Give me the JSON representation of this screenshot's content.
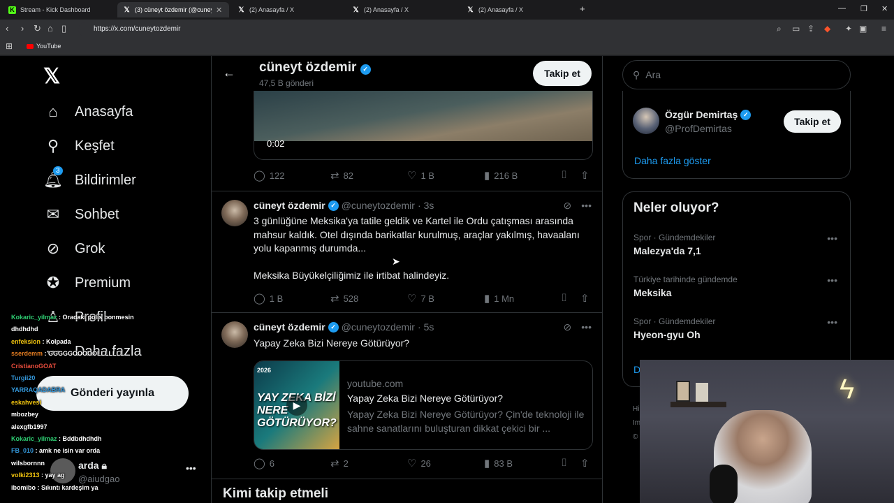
{
  "browser": {
    "tabs": [
      {
        "title": "Stream - Kick Dashboard",
        "icon": "kick-icon"
      },
      {
        "title": "(3) cüneyt özdemir (@cuneytozd",
        "icon": "x-icon"
      },
      {
        "title": "(2) Anasayfa / X",
        "icon": "x-icon"
      },
      {
        "title": "(2) Anasayfa / X",
        "icon": "x-icon"
      },
      {
        "title": "(2) Anasayfa / X",
        "icon": "x-icon"
      }
    ],
    "url": "https://x.com/cuneytozdemir",
    "bookmarks": [
      {
        "label": "YouTube"
      }
    ]
  },
  "nav": {
    "items": [
      {
        "label": "Anasayfa",
        "icon": "home-icon"
      },
      {
        "label": "Keşfet",
        "icon": "search-icon"
      },
      {
        "label": "Bildirimler",
        "icon": "bell-icon",
        "badge": "3"
      },
      {
        "label": "Sohbet",
        "icon": "mail-icon"
      },
      {
        "label": "Grok",
        "icon": "grok-icon"
      },
      {
        "label": "Premium",
        "icon": "verified-icon"
      },
      {
        "label": "Profil",
        "icon": "person-icon"
      },
      {
        "label": "Daha fazla",
        "icon": "more-circle-icon"
      }
    ],
    "post_button": "Gönderi yayınla",
    "account": {
      "name": "arda",
      "handle": "@aiudgao"
    }
  },
  "chat": [
    {
      "user": "Kokaric_yilmaz",
      "msg": "Oradaki polis bonmesin",
      "color": "#2ecc71"
    },
    {
      "user": "",
      "msg": "dhdhdhd",
      "color": "#fff"
    },
    {
      "user": "enfeksion",
      "msg": "Kolpada",
      "color": "#f1c40f"
    },
    {
      "user": "sserdemm",
      "msg": "GGGGGOOOOOLLLLLLL",
      "color": "#e67e22"
    },
    {
      "user": "CristianoGOAT",
      "msg": "",
      "color": "#e74c3c"
    },
    {
      "user": "Turgii20",
      "msg": "",
      "color": "#3498db"
    },
    {
      "user": "YARRAQADABRA",
      "msg": "",
      "color": "#3498db"
    },
    {
      "user": "eskahvesi",
      "msg": "",
      "color": "#f1c40f"
    },
    {
      "user": "mbozbey",
      "msg": "",
      "color": "#fff"
    },
    {
      "user": "alexgfb1997",
      "msg": "",
      "color": "#fff"
    },
    {
      "user": "Kokaric_yilmaz",
      "msg": "Bddbdhdhdh",
      "color": "#2ecc71"
    },
    {
      "user": "FB_010",
      "msg": "amk ne isin var orda",
      "color": "#3498db"
    },
    {
      "user": "wilsbornnn",
      "msg": "",
      "color": "#fff"
    },
    {
      "user": "volki2313",
      "msg": "yay ag",
      "color": "#f1c40f"
    },
    {
      "user": "ibomibo",
      "msg": "Sıkıntı kardeşim ya",
      "color": "#fff"
    }
  ],
  "profile": {
    "name": "cüneyt özdemir",
    "post_count": "47,5 B gönderi",
    "follow_label": "Takip et"
  },
  "video": {
    "time": "0:02"
  },
  "tweets": [
    {
      "stats": {
        "replies": "122",
        "reposts": "82",
        "likes": "1 B",
        "views": "216 B"
      }
    },
    {
      "name": "cüneyt özdemir",
      "handle": "@cuneytozdemir",
      "time": "3s",
      "text1": "3 günlüğüne Meksika'ya tatile geldik ve Kartel ile Ordu çatışması arasında mahsur kaldık. Otel dışında barikatlar kurulmuş, araçlar yakılmış, havaalanı yolu kapanmış durumda...",
      "text2": "Meksika Büyükelçiliğimiz ile irtibat halindeyiz.",
      "stats": {
        "replies": "1 B",
        "reposts": "528",
        "likes": "7 B",
        "views": "1 Mn"
      }
    },
    {
      "name": "cüneyt özdemir",
      "handle": "@cuneytozdemir",
      "time": "5s",
      "text1": "Yapay Zeka Bizi Nereye Götürüyor?",
      "card": {
        "domain": "youtube.com",
        "title": "Yapay Zeka Bizi Nereye Götürüyor?",
        "desc": "Yapay Zeka Bizi Nereye Götürüyor? Çin'de teknoloji ile sahne sanatlarını buluşturan dikkat çekici bir ...",
        "thumb_text": "YAY ZEKA BİZİ NERE GÖTÜRÜYOR?",
        "thumb_year": "2026"
      },
      "stats": {
        "replies": "6",
        "reposts": "2",
        "likes": "26",
        "views": "83 B"
      }
    }
  ],
  "who_to_follow_heading": "Kimi takip etmeli",
  "sidebar": {
    "search_placeholder": "Ara",
    "suggest": {
      "name": "Özgür Demirtaş",
      "handle": "@ProfDemirtas",
      "follow_label": "Takip et"
    },
    "show_more": "Daha fazla göster",
    "trends_title": "Neler oluyor?",
    "trends": [
      {
        "context": "Spor · Gündemdekiler",
        "name": "Malezya'da 7,1"
      },
      {
        "context": "Türkiye tarihinde gündemde",
        "name": "Meksika"
      },
      {
        "context": "Spor · Gündemdekiler",
        "name": "Hyeon-gyu Oh"
      }
    ],
    "trends_show_more": "D",
    "footer": [
      "Hi",
      "Im",
      "©"
    ]
  }
}
